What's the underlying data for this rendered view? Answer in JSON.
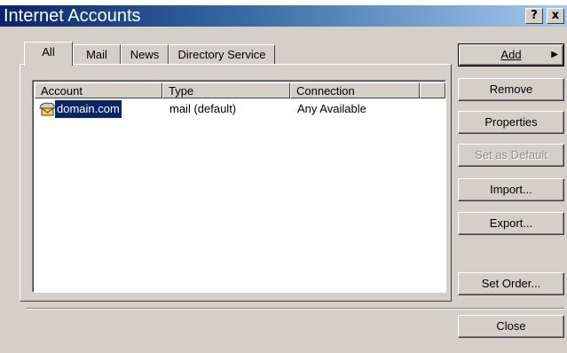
{
  "window": {
    "title": "Internet Accounts",
    "help_label": "?",
    "close_label": "x"
  },
  "tabs": [
    {
      "label": "All"
    },
    {
      "label": "Mail"
    },
    {
      "label": "News"
    },
    {
      "label": "Directory Service"
    }
  ],
  "list": {
    "columns": [
      "Account",
      "Type",
      "Connection"
    ],
    "rows": [
      {
        "account": "domain.com",
        "type": "mail (default)",
        "connection": "Any Available",
        "icon": "mail-account-icon",
        "selected": true
      }
    ]
  },
  "buttons": {
    "add": "Add",
    "remove": "Remove",
    "properties": "Properties",
    "set_default": "Set as Default",
    "import": "Import...",
    "export": "Export...",
    "set_order": "Set Order...",
    "close": "Close"
  },
  "colors": {
    "selection": "#0a246a",
    "face": "#d4d0c8",
    "title_start": "#0a246a",
    "title_end": "#a6caf0"
  }
}
